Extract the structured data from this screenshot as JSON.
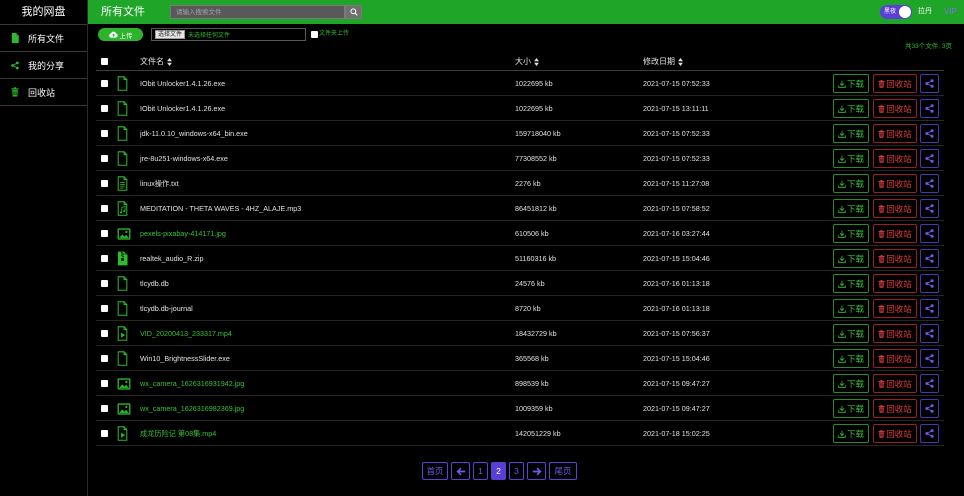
{
  "sidebar": {
    "title": "我的网盘",
    "items": [
      {
        "label": "所有文件",
        "icon": "file-icon"
      },
      {
        "label": "我的分享",
        "icon": "share-icon"
      },
      {
        "label": "回收站",
        "icon": "trash-icon"
      }
    ]
  },
  "topbar": {
    "title": "所有文件",
    "search_placeholder": "请输入搜索文件",
    "search_icon": "search-icon",
    "theme_toggle_label": "黑夜",
    "theme_toggle_on": true,
    "username": "拉丹",
    "vip_label": "VIP"
  },
  "toolbar": {
    "upload_label": "上传",
    "upload_icon": "cloud-upload-icon",
    "choose_file_label": "选择文件",
    "no_file_label": "未选择任何文件",
    "folder_upload_label": "文件夹上传",
    "summary": "共33个文件, 3页"
  },
  "table": {
    "columns": {
      "name": "文件名",
      "size": "大小",
      "date": "修改日期"
    },
    "actions": {
      "download": "下载",
      "recycle": "回收站"
    },
    "rows": [
      {
        "icon": "file-icon",
        "name": "IObit Unlocker1.4.1.26.exe",
        "size": "1022695 kb",
        "date": "2021-07-15 07:52:33"
      },
      {
        "icon": "file-icon",
        "name": "IObit Unlocker1.4.1.26.exe",
        "size": "1022695 kb",
        "date": "2021-07-15 13:11:11"
      },
      {
        "icon": "file-icon",
        "name": "jdk-11.0.10_windows-x64_bin.exe",
        "size": "159718040 kb",
        "date": "2021-07-15 07:52:33"
      },
      {
        "icon": "file-icon",
        "name": "jre-8u251-windows-x64.exe",
        "size": "77308552 kb",
        "date": "2021-07-15 07:52:33"
      },
      {
        "icon": "text-file-icon",
        "name": "linux操作.txt",
        "size": "2276 kb",
        "date": "2021-07-15 11:27:08"
      },
      {
        "icon": "music-file-icon",
        "name": "MEDITATION - THETA WAVES - 4HZ_ALAJE.mp3",
        "size": "86451812 kb",
        "date": "2021-07-15 07:58:52"
      },
      {
        "icon": "image-file-icon",
        "name": "pexels-pixabay-414171.jpg",
        "size": "610506 kb",
        "date": "2021-07-16 03:27:44"
      },
      {
        "icon": "zip-file-icon",
        "name": "realtek_audio_R.zip",
        "size": "51160316 kb",
        "date": "2021-07-15 15:04:46"
      },
      {
        "icon": "file-icon",
        "name": "tlcydb.db",
        "size": "24576 kb",
        "date": "2021-07-16 01:13:18"
      },
      {
        "icon": "file-icon",
        "name": "tlcydb.db-journal",
        "size": "8720 kb",
        "date": "2021-07-16 01:13:18"
      },
      {
        "icon": "video-file-icon",
        "name": "VID_20200413_233317.mp4",
        "size": "18432729 kb",
        "date": "2021-07-15 07:56:37"
      },
      {
        "icon": "file-icon",
        "name": "Win10_BrightnessSlider.exe",
        "size": "365568 kb",
        "date": "2021-07-15 15:04:46"
      },
      {
        "icon": "image-file-icon",
        "name": "wx_camera_1626316931942.jpg",
        "size": "898539 kb",
        "date": "2021-07-15 09:47:27"
      },
      {
        "icon": "image-file-icon",
        "name": "wx_camera_1626316982369.jpg",
        "size": "1009359 kb",
        "date": "2021-07-15 09:47:27"
      },
      {
        "icon": "video-file-icon",
        "name": "成龙历险记 第08集.mp4",
        "size": "142051229 kb",
        "date": "2021-07-18 15:02:25"
      }
    ]
  },
  "pagination": {
    "first": "首页",
    "pages": [
      "1",
      "2",
      "3"
    ],
    "current": "2",
    "last": "尾页"
  },
  "colors": {
    "topbar": "#1fa528",
    "accent_green": "#2dbb2d",
    "link_green": "#36c236",
    "danger_red": "#e23b3b",
    "purple": "#5a3fd6",
    "background": "#000000"
  }
}
